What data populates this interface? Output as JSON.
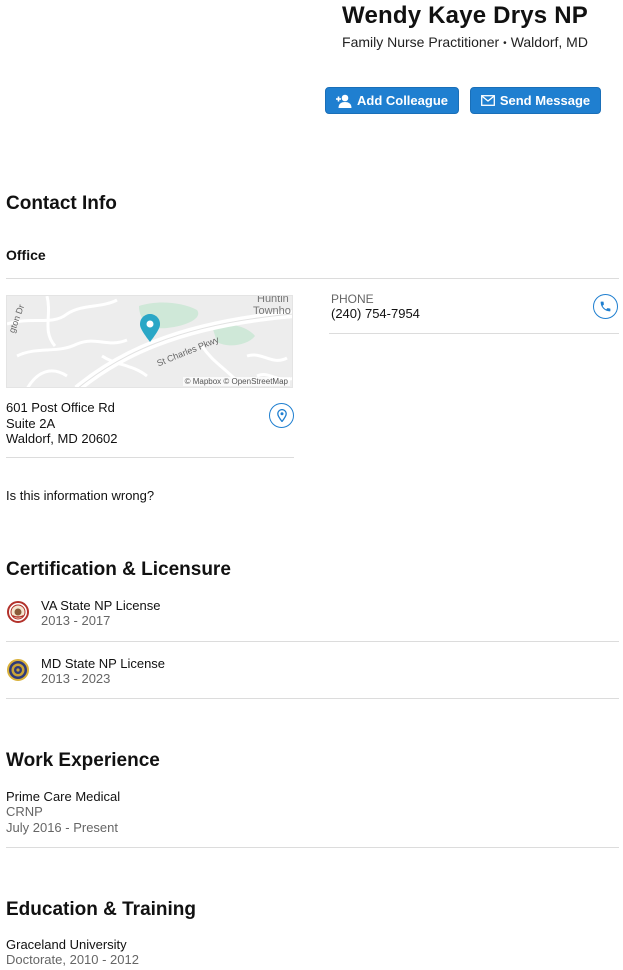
{
  "header": {
    "name": "Wendy Kaye Drys NP",
    "specialty": "Family Nurse Practitioner",
    "separator": "•",
    "location": "Waldorf, MD",
    "buttons": {
      "add_colleague": "Add Colleague",
      "send_message": "Send Message"
    }
  },
  "contact": {
    "title": "Contact Info",
    "office_label": "Office",
    "map": {
      "street_labels": [
        "St Charles Pkwy",
        "gton Dr",
        "Huntin",
        "Townho"
      ],
      "credit": "© Mapbox © OpenStreetMap"
    },
    "address": {
      "line1": "601 Post Office Rd",
      "line2": "Suite 2A",
      "line3": "Waldorf, MD 20602"
    },
    "phone_label": "PHONE",
    "phone": "(240) 754-7954",
    "wrong_info": "Is this information wrong?"
  },
  "certifications": {
    "title": "Certification & Licensure",
    "items": [
      {
        "name": "VA State NP License",
        "years": "2013 - 2017",
        "badge_color": "#b3322b"
      },
      {
        "name": "MD State NP License",
        "years": "2013 - 2023",
        "badge_color": "#2e3a7a"
      }
    ]
  },
  "work": {
    "title": "Work Experience",
    "items": [
      {
        "employer": "Prime Care Medical",
        "role": "CRNP",
        "dates": "July 2016 - Present"
      }
    ]
  },
  "education": {
    "title": "Education & Training",
    "items": [
      {
        "school": "Graceland University",
        "degree": "Doctorate, 2010 - 2012"
      }
    ]
  },
  "colors": {
    "accent": "#1f7fd0",
    "map_pin": "#2aa7c6",
    "divider": "#dcdcdc"
  }
}
